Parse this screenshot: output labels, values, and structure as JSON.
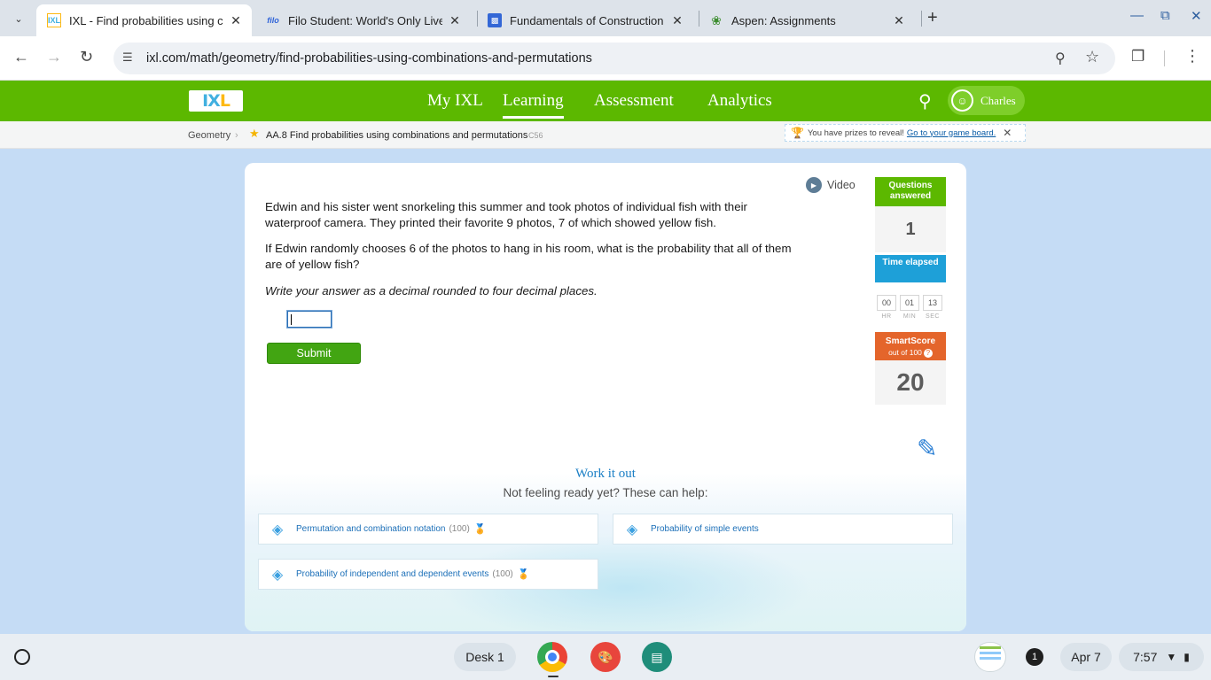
{
  "browser": {
    "tabs": [
      {
        "favicon": "IXL",
        "title": "IXL - Find probabilities using co",
        "active": true
      },
      {
        "favicon": "filo",
        "title": "Filo Student: World's Only Live I",
        "active": false
      },
      {
        "favicon": "doc-icon",
        "title": "Fundamentals of Construction",
        "active": false
      },
      {
        "favicon": "leaf-icon",
        "title": "Aspen: Assignments",
        "active": false
      }
    ],
    "url": "ixl.com/math/geometry/find-probabilities-using-combinations-and-permutations"
  },
  "ixl": {
    "logo": {
      "i": "I",
      "x": "X",
      "l": "L"
    },
    "nav": [
      "My IXL",
      "Learning",
      "Assessment",
      "Analytics"
    ],
    "user": "Charles",
    "breadcrumb": {
      "subject": "Geometry",
      "skill": "AA.8 Find probabilities using combinations and permutations",
      "code": "C56"
    },
    "prize": {
      "text": "You have prizes to reveal!",
      "link": "Go to your game board."
    }
  },
  "question": {
    "video_label": "Video",
    "paragraph1": "Edwin and his sister went snorkeling this summer and took photos of individual fish with their waterproof camera. They printed their favorite 9 photos, 7 of which showed yellow fish.",
    "paragraph2": "If Edwin randomly chooses 6 of the photos to hang in his room, what is the probability that all of them are of yellow fish?",
    "instruction": "Write your answer as a decimal rounded to four decimal places.",
    "answer_value": "",
    "submit_label": "Submit"
  },
  "stats": {
    "questions_label": "Questions answered",
    "questions_value": "1",
    "time_label": "Time elapsed",
    "time": {
      "hr": "00",
      "min": "01",
      "sec": "13"
    },
    "time_units": {
      "hr": "HR",
      "min": "MIN",
      "sec": "SEC"
    },
    "smartscore_label": "SmartScore",
    "smartscore_sub": "out of 100",
    "smartscore_value": "20",
    "colors": {
      "questions": "#5cb800",
      "time": "#1ea0d8",
      "smartscore": "#e4652b"
    }
  },
  "work_it_out": {
    "title": "Work it out",
    "subtitle": "Not feeling ready yet? These can help:",
    "skills": [
      {
        "name": "Permutation and combination notation",
        "score": "(100)",
        "medal": true
      },
      {
        "name": "Probability of simple events",
        "score": "",
        "medal": false
      },
      {
        "name": "Probability of independent and dependent events",
        "score": "(100)",
        "medal": true
      }
    ]
  },
  "shelf": {
    "desk": "Desk 1",
    "notifications": "1",
    "date": "Apr 7",
    "time": "7:57"
  }
}
